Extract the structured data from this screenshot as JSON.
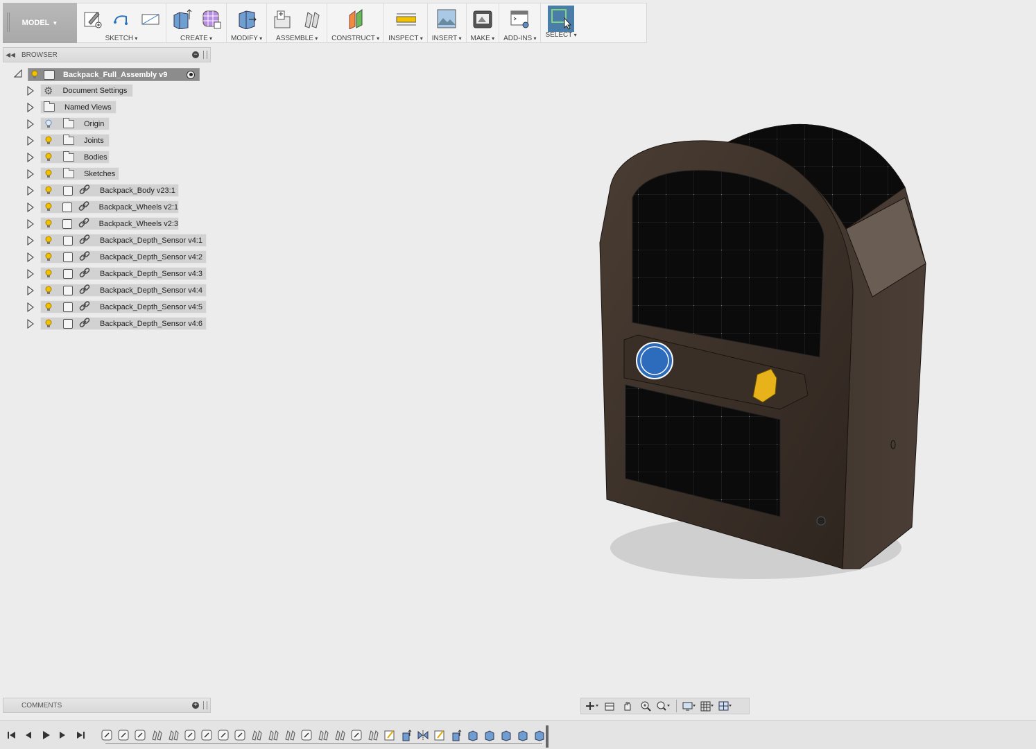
{
  "toolbar": {
    "workspace_label": "MODEL",
    "groups": [
      {
        "label": "SKETCH",
        "icons": [
          "create-sketch-icon",
          "line-icon",
          "rectangle-icon"
        ]
      },
      {
        "label": "CREATE",
        "icons": [
          "extrude-icon",
          "form-icon"
        ]
      },
      {
        "label": "MODIFY",
        "icons": [
          "press-pull-icon"
        ]
      },
      {
        "label": "ASSEMBLE",
        "icons": [
          "new-component-icon",
          "joint-icon"
        ]
      },
      {
        "label": "CONSTRUCT",
        "icons": [
          "offset-plane-icon"
        ]
      },
      {
        "label": "INSPECT",
        "icons": [
          "measure-icon"
        ]
      },
      {
        "label": "INSERT",
        "icons": [
          "insert-image-icon"
        ]
      },
      {
        "label": "MAKE",
        "icons": [
          "3d-print-icon"
        ]
      },
      {
        "label": "ADD-INS",
        "icons": [
          "scripts-icon"
        ]
      },
      {
        "label": "SELECT",
        "icons": [
          "select-icon"
        ]
      }
    ]
  },
  "browser": {
    "title": "BROWSER",
    "root": "Backpack_Full_Assembly v9",
    "items": [
      {
        "label": "Document Settings",
        "kind": "settings"
      },
      {
        "label": "Named Views",
        "kind": "folder-nobulb"
      },
      {
        "label": "Origin",
        "kind": "folder-off"
      },
      {
        "label": "Joints",
        "kind": "folder"
      },
      {
        "label": "Bodies",
        "kind": "folder"
      },
      {
        "label": "Sketches",
        "kind": "folder"
      },
      {
        "label": "Backpack_Body v23:1",
        "kind": "component"
      },
      {
        "label": "Backpack_Wheels v2:1",
        "kind": "component"
      },
      {
        "label": "Backpack_Wheels v2:3",
        "kind": "component"
      },
      {
        "label": "Backpack_Depth_Sensor v4:1",
        "kind": "component"
      },
      {
        "label": "Backpack_Depth_Sensor v4:2",
        "kind": "component"
      },
      {
        "label": "Backpack_Depth_Sensor v4:3",
        "kind": "component"
      },
      {
        "label": "Backpack_Depth_Sensor v4:4",
        "kind": "component"
      },
      {
        "label": "Backpack_Depth_Sensor v4:5",
        "kind": "component"
      },
      {
        "label": "Backpack_Depth_Sensor v4:6",
        "kind": "component"
      }
    ]
  },
  "comments": {
    "title": "COMMENTS"
  },
  "colors": {
    "select_active": "#4a7ea8",
    "bulb": "#f2c200",
    "model_dark": "#3a2e26"
  },
  "timeline": {
    "feature_count": 27
  }
}
